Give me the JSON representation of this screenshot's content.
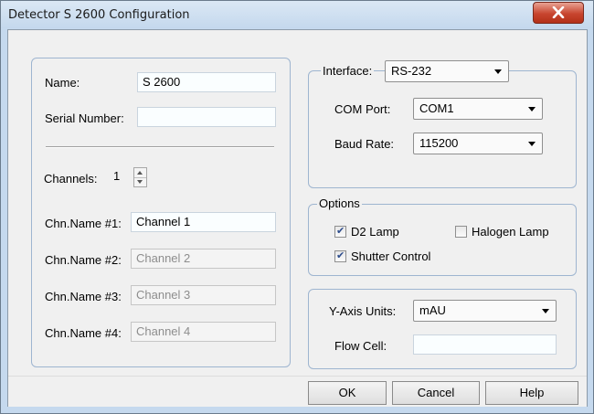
{
  "window": {
    "title": "Detector S 2600 Configuration"
  },
  "left": {
    "name_label": "Name:",
    "name_value": "S 2600",
    "serial_label": "Serial Number:",
    "serial_value": "",
    "channels_label": "Channels:",
    "channels_value": "1",
    "channel_names": [
      {
        "label": "Chn.Name #1:",
        "value": "Channel 1",
        "enabled": true
      },
      {
        "label": "Chn.Name #2:",
        "value": "Channel 2",
        "enabled": false
      },
      {
        "label": "Chn.Name #3:",
        "value": "Channel 3",
        "enabled": false
      },
      {
        "label": "Chn.Name #4:",
        "value": "Channel 4",
        "enabled": false
      }
    ]
  },
  "interface": {
    "label": "Interface:",
    "value": "RS-232",
    "com_port_label": "COM Port:",
    "com_port_value": "COM1",
    "baud_rate_label": "Baud Rate:",
    "baud_rate_value": "115200"
  },
  "options": {
    "title": "Options",
    "d2_lamp": {
      "label": "D2 Lamp",
      "checked": true
    },
    "halogen_lamp": {
      "label": "Halogen Lamp",
      "checked": false
    },
    "shutter_control": {
      "label": "Shutter Control",
      "checked": true
    }
  },
  "units": {
    "y_axis_label": "Y-Axis Units:",
    "y_axis_value": "mAU",
    "flow_cell_label": "Flow Cell:",
    "flow_cell_value": ""
  },
  "buttons": {
    "ok": "OK",
    "cancel": "Cancel",
    "help": "Help"
  },
  "icons": {
    "close": "close-icon",
    "dropdown": "chevron-down-icon",
    "spin_up": "spin-up-icon",
    "spin_down": "spin-down-icon"
  },
  "colors": {
    "close_button": "#c8452f",
    "frame": "#c5d9ee",
    "group_border": "#9eb5d0"
  }
}
